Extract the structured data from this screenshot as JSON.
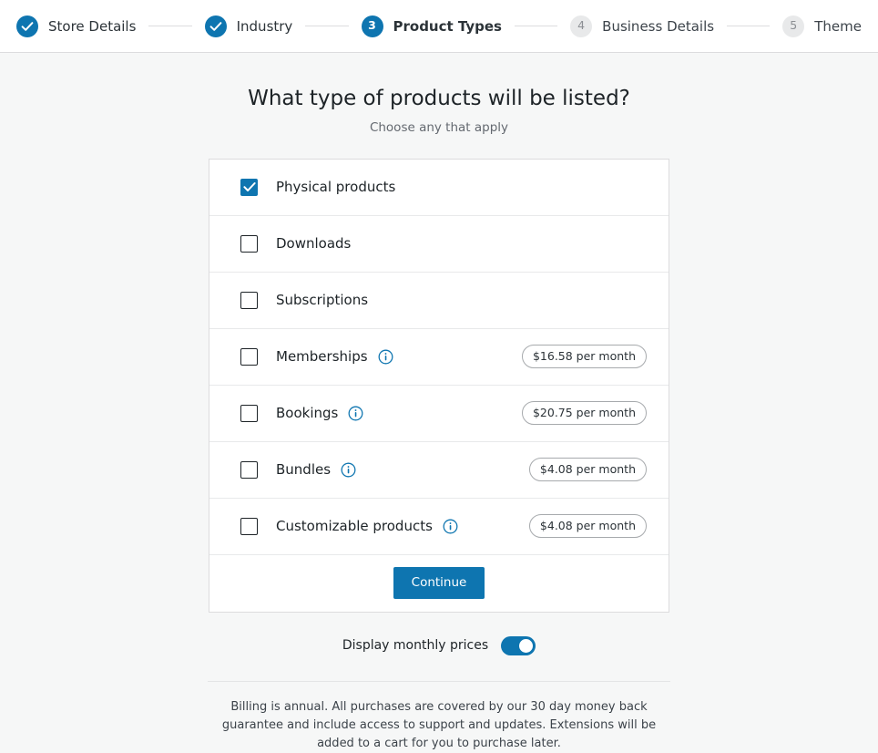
{
  "stepper": {
    "steps": [
      {
        "number": "1",
        "label": "Store Details",
        "state": "done",
        "icon": "check-icon"
      },
      {
        "number": "2",
        "label": "Industry",
        "state": "done",
        "icon": "check-icon"
      },
      {
        "number": "3",
        "label": "Product Types",
        "state": "current",
        "icon": ""
      },
      {
        "number": "4",
        "label": "Business Details",
        "state": "todo",
        "icon": ""
      },
      {
        "number": "5",
        "label": "Theme",
        "state": "todo",
        "icon": ""
      }
    ]
  },
  "main": {
    "title": "What type of products will be listed?",
    "subtitle": "Choose any that apply",
    "options": [
      {
        "label": "Physical products",
        "checked": true,
        "info": false,
        "price": ""
      },
      {
        "label": "Downloads",
        "checked": false,
        "info": false,
        "price": ""
      },
      {
        "label": "Subscriptions",
        "checked": false,
        "info": false,
        "price": ""
      },
      {
        "label": "Memberships",
        "checked": false,
        "info": true,
        "price": "$16.58 per month"
      },
      {
        "label": "Bookings",
        "checked": false,
        "info": true,
        "price": "$20.75 per month"
      },
      {
        "label": "Bundles",
        "checked": false,
        "info": true,
        "price": "$4.08 per month"
      },
      {
        "label": "Customizable products",
        "checked": false,
        "info": true,
        "price": "$4.08 per month"
      }
    ],
    "continue_label": "Continue"
  },
  "toggle": {
    "label": "Display monthly prices",
    "on": true
  },
  "footer": {
    "note": "Billing is annual. All purchases are covered by our 30 day money back guarantee and include access to support and updates. Extensions will be added to a cart for you to purchase later."
  },
  "colors": {
    "accent": "#0e75b0",
    "page_bg": "#f6f7f7",
    "card_bg": "#ffffff",
    "border": "#dcdcde",
    "text": "#1d2327",
    "muted_text": "#646970",
    "todo_circle": "#e8e9ea",
    "todo_number": "#8c8f94"
  }
}
